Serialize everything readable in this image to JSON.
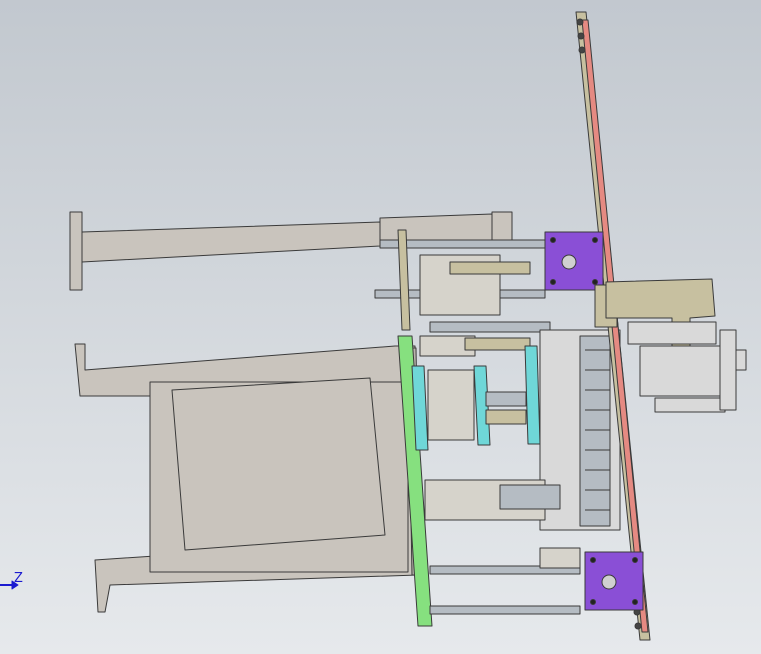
{
  "axis_triad": {
    "label": "Z"
  },
  "colors": {
    "frame": "#c9c4bd",
    "olive": "#c7c0a0",
    "purple": "#8a4fd6",
    "green": "#86e07f",
    "cyan": "#6fd7d8",
    "red": "#e58a82",
    "rod": "#b5bcc3",
    "axis": "#1a1ad0"
  }
}
